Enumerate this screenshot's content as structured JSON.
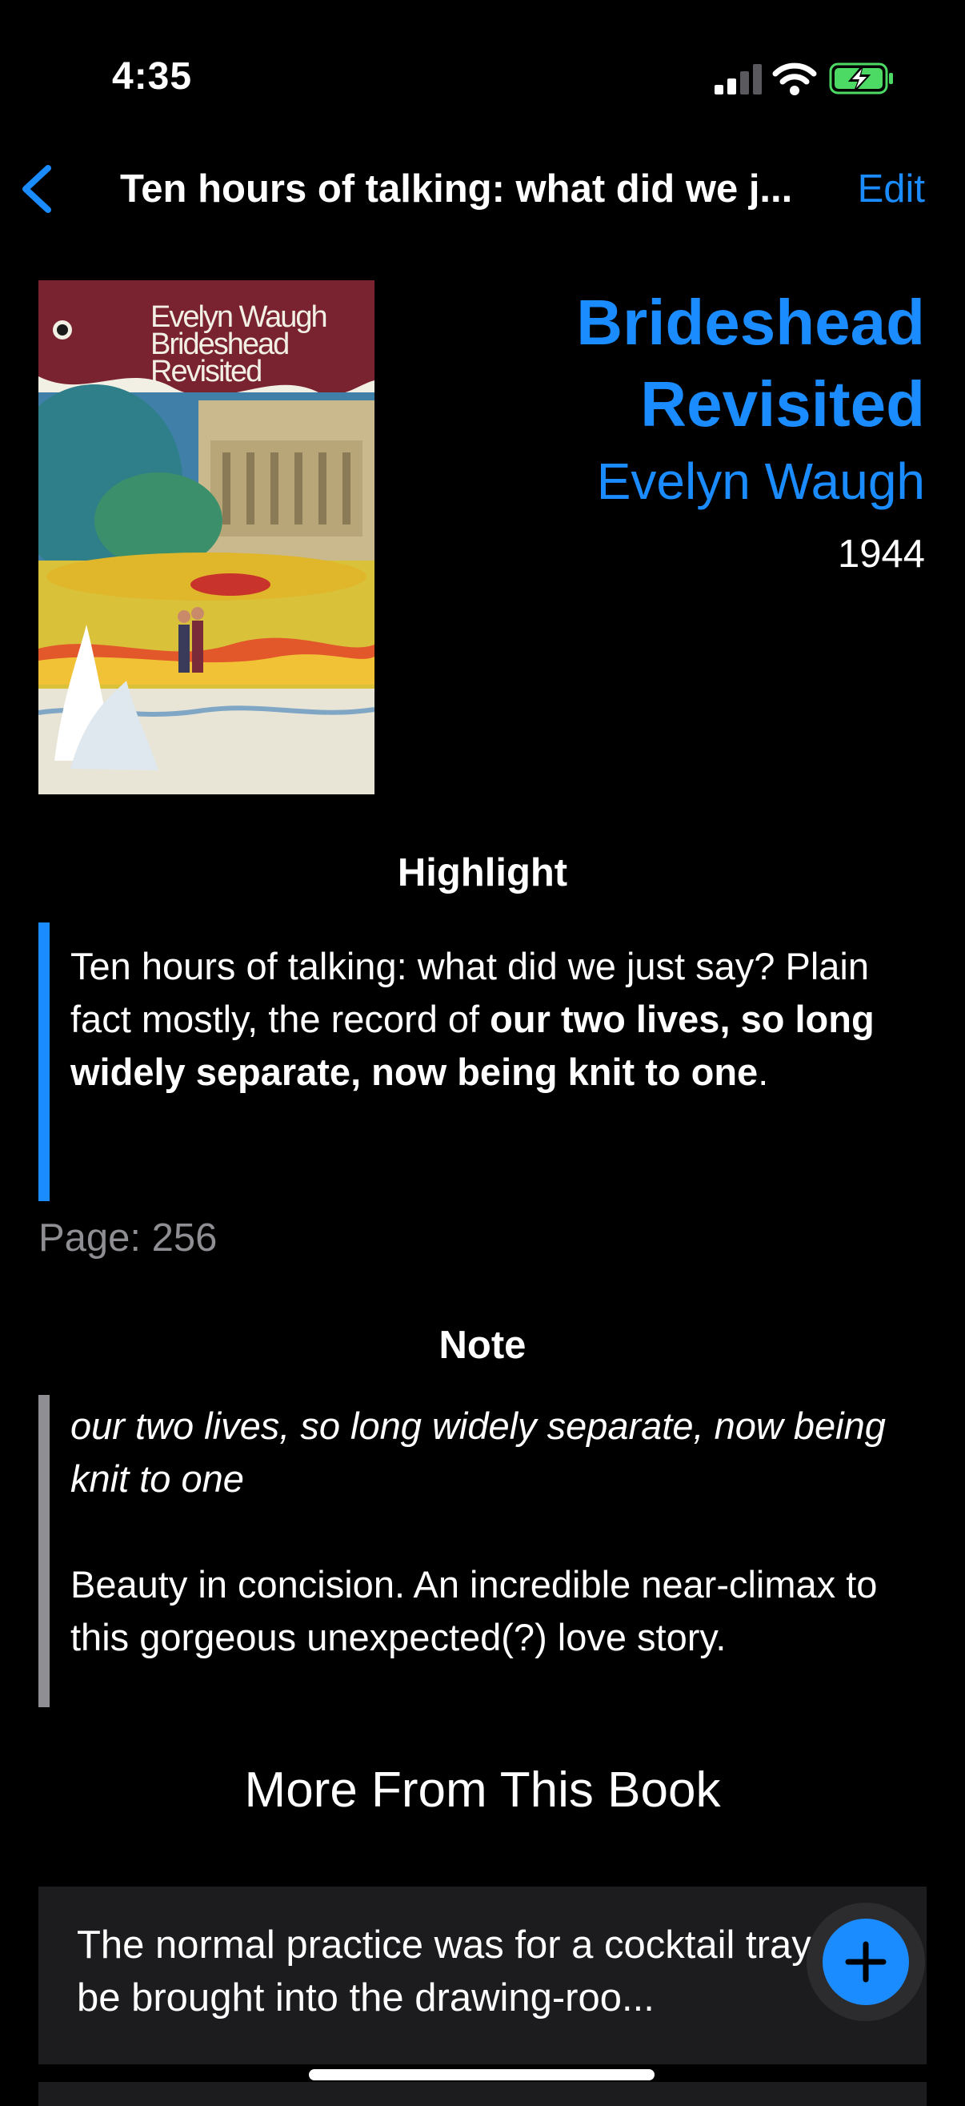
{
  "status_bar": {
    "time": "4:35"
  },
  "nav": {
    "title": "Ten hours of talking: what did we j...",
    "edit_label": "Edit"
  },
  "book": {
    "title": "Brideshead Revisited",
    "author": "Evelyn Waugh",
    "year": "1944",
    "cover_text": {
      "author": "Evelyn Waugh",
      "title_line1": "Brideshead",
      "title_line2": "Revisited"
    }
  },
  "highlight": {
    "heading": "Highlight",
    "text_plain": "Ten hours of talking: what did we just say? Plain fact mostly, the record of ",
    "text_bold": "our two lives, so long widely separate, now being knit to one",
    "text_end": ".",
    "page_label": "Page: 256"
  },
  "note": {
    "heading": "Note",
    "quote_italic": "our two lives, so long widely separate, now being knit to one",
    "body": "Beauty in concision. An incredible near-climax to this gorgeous unexpected(?) love story."
  },
  "more": {
    "heading": "More From This Book",
    "items": [
      {
        "text": "The normal practice was for a cocktail tray to be brought into the drawing-roo..."
      }
    ]
  },
  "colors": {
    "accent": "#1a8cff",
    "highlight_bar": "#1a8cff",
    "note_bar": "#8e8e93",
    "battery": "#4cd964"
  },
  "icons": {
    "back": "chevron-left-icon",
    "add": "plus-icon"
  }
}
